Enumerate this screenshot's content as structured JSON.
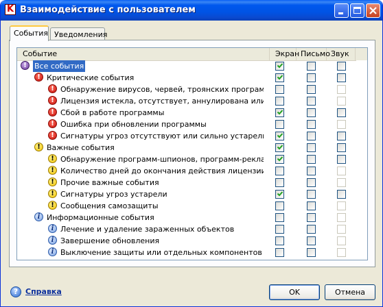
{
  "window": {
    "title": "Взаимодействие с пользователем",
    "app_icon_letter": "K"
  },
  "tabs": [
    {
      "label": "События",
      "active": true
    },
    {
      "label": "Уведомления",
      "active": false
    }
  ],
  "columns": {
    "event": "Событие",
    "screen": "Экран",
    "mail": "Письмо",
    "sound": "Звук"
  },
  "rows": [
    {
      "label": "Все события",
      "icon": "all-events-icon",
      "level": 0,
      "selected": true,
      "screen": true,
      "mail": false,
      "sound": false,
      "mail_disabled": false,
      "sound_disabled": false
    },
    {
      "label": "Критические события",
      "icon": "critical-icon",
      "level": 1,
      "screen": true,
      "mail": false,
      "sound": false,
      "mail_disabled": false,
      "sound_disabled": false
    },
    {
      "label": "Обнаружение вирусов, червей, троянских программ",
      "icon": "critical-icon",
      "level": 2,
      "screen": false,
      "mail": false,
      "sound": false,
      "mail_disabled": false,
      "sound_disabled": true
    },
    {
      "label": "Лицензия истекла, отсутствует, аннулирована или по...",
      "icon": "critical-icon",
      "level": 2,
      "screen": false,
      "mail": false,
      "sound": false,
      "mail_disabled": false,
      "sound_disabled": true
    },
    {
      "label": "Сбой в работе программы",
      "icon": "critical-icon",
      "level": 2,
      "screen": true,
      "mail": false,
      "sound": false,
      "mail_disabled": false,
      "sound_disabled": false
    },
    {
      "label": "Ошибка при обновлении программы",
      "icon": "critical-icon",
      "level": 2,
      "screen": false,
      "mail": false,
      "sound": false,
      "mail_disabled": false,
      "sound_disabled": true
    },
    {
      "label": "Сигнатуры угроз отсутствуют или сильно устарели",
      "icon": "critical-icon",
      "level": 2,
      "screen": true,
      "mail": false,
      "sound": false,
      "mail_disabled": false,
      "sound_disabled": false
    },
    {
      "label": "Важные события",
      "icon": "warning-icon",
      "level": 1,
      "screen": true,
      "mail": false,
      "sound": false,
      "mail_disabled": false,
      "sound_disabled": false
    },
    {
      "label": "Обнаружение программ-шпионов, программ-реклам и п...",
      "icon": "warning-icon",
      "level": 2,
      "screen": true,
      "mail": false,
      "sound": false,
      "mail_disabled": false,
      "sound_disabled": false
    },
    {
      "label": "Количество дней до окончания действия лицензии",
      "icon": "warning-icon",
      "level": 2,
      "screen": false,
      "mail": false,
      "sound": false,
      "mail_disabled": false,
      "sound_disabled": true
    },
    {
      "label": "Прочие важные события",
      "icon": "warning-icon",
      "level": 2,
      "screen": false,
      "mail": false,
      "sound": false,
      "mail_disabled": false,
      "sound_disabled": true
    },
    {
      "label": "Сигнатуры угроз устарели",
      "icon": "warning-icon",
      "level": 2,
      "screen": true,
      "mail": false,
      "sound": false,
      "mail_disabled": false,
      "sound_disabled": false
    },
    {
      "label": "Сообщения самозащиты",
      "icon": "warning-icon",
      "level": 2,
      "screen": false,
      "mail": false,
      "sound": false,
      "mail_disabled": false,
      "sound_disabled": true
    },
    {
      "label": "Информационные события",
      "icon": "info-icon",
      "level": 1,
      "screen": false,
      "mail": false,
      "sound": false,
      "mail_disabled": false,
      "sound_disabled": true
    },
    {
      "label": "Лечение и удаление зараженных объектов",
      "icon": "info-icon",
      "level": 2,
      "screen": false,
      "mail": false,
      "sound": false,
      "mail_disabled": false,
      "sound_disabled": true
    },
    {
      "label": "Завершение обновления",
      "icon": "info-icon",
      "level": 2,
      "screen": false,
      "mail": false,
      "sound": false,
      "mail_disabled": false,
      "sound_disabled": true
    },
    {
      "label": "Выключение защиты или отдельных компонентов",
      "icon": "info-icon",
      "level": 2,
      "screen": false,
      "mail": false,
      "sound": false,
      "mail_disabled": false,
      "sound_disabled": true
    }
  ],
  "footer": {
    "help_label": "Справка",
    "ok_label": "OK",
    "cancel_label": "Отмена"
  },
  "colors": {
    "selection": "#316ac5",
    "title_bar": "#0053e4",
    "checkmark": "#21a121"
  }
}
